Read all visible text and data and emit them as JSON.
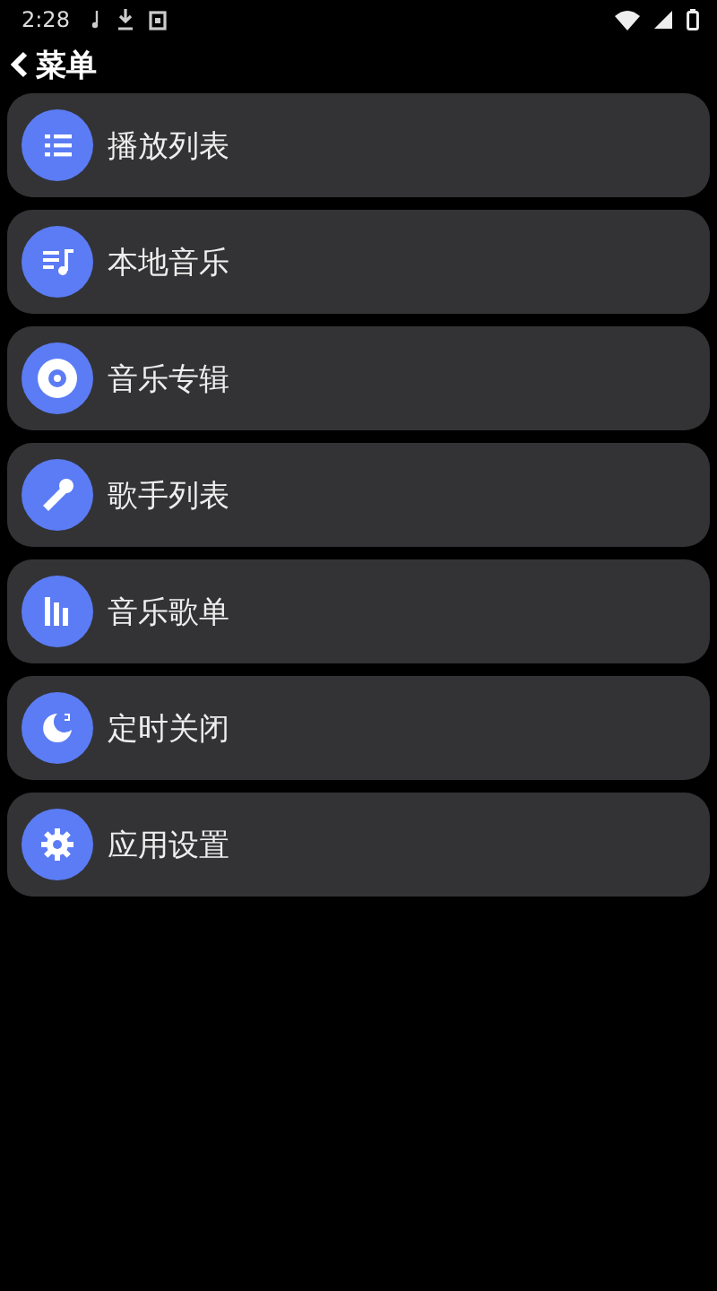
{
  "status_bar": {
    "time": "2:28"
  },
  "header": {
    "title": "菜单"
  },
  "menu_items": [
    {
      "label": "播放列表",
      "kind": "list"
    },
    {
      "label": "本地音乐",
      "kind": "music"
    },
    {
      "label": "音乐专辑",
      "kind": "disc"
    },
    {
      "label": "歌手列表",
      "kind": "mic"
    },
    {
      "label": "音乐歌单",
      "kind": "bars"
    },
    {
      "label": "定时关闭",
      "kind": "moon"
    },
    {
      "label": "应用设置",
      "kind": "gear"
    }
  ]
}
